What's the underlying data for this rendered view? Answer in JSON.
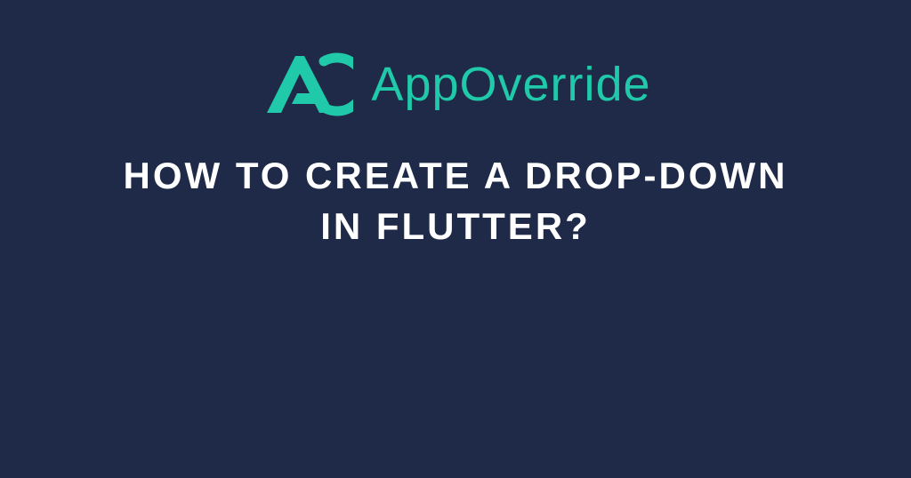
{
  "brand": {
    "name": "AppOverride",
    "accent_color": "#1fc9a9"
  },
  "content": {
    "title": "HOW TO CREATE A DROP-DOWN IN FLUTTER?"
  },
  "background_color": "#1e2a47"
}
